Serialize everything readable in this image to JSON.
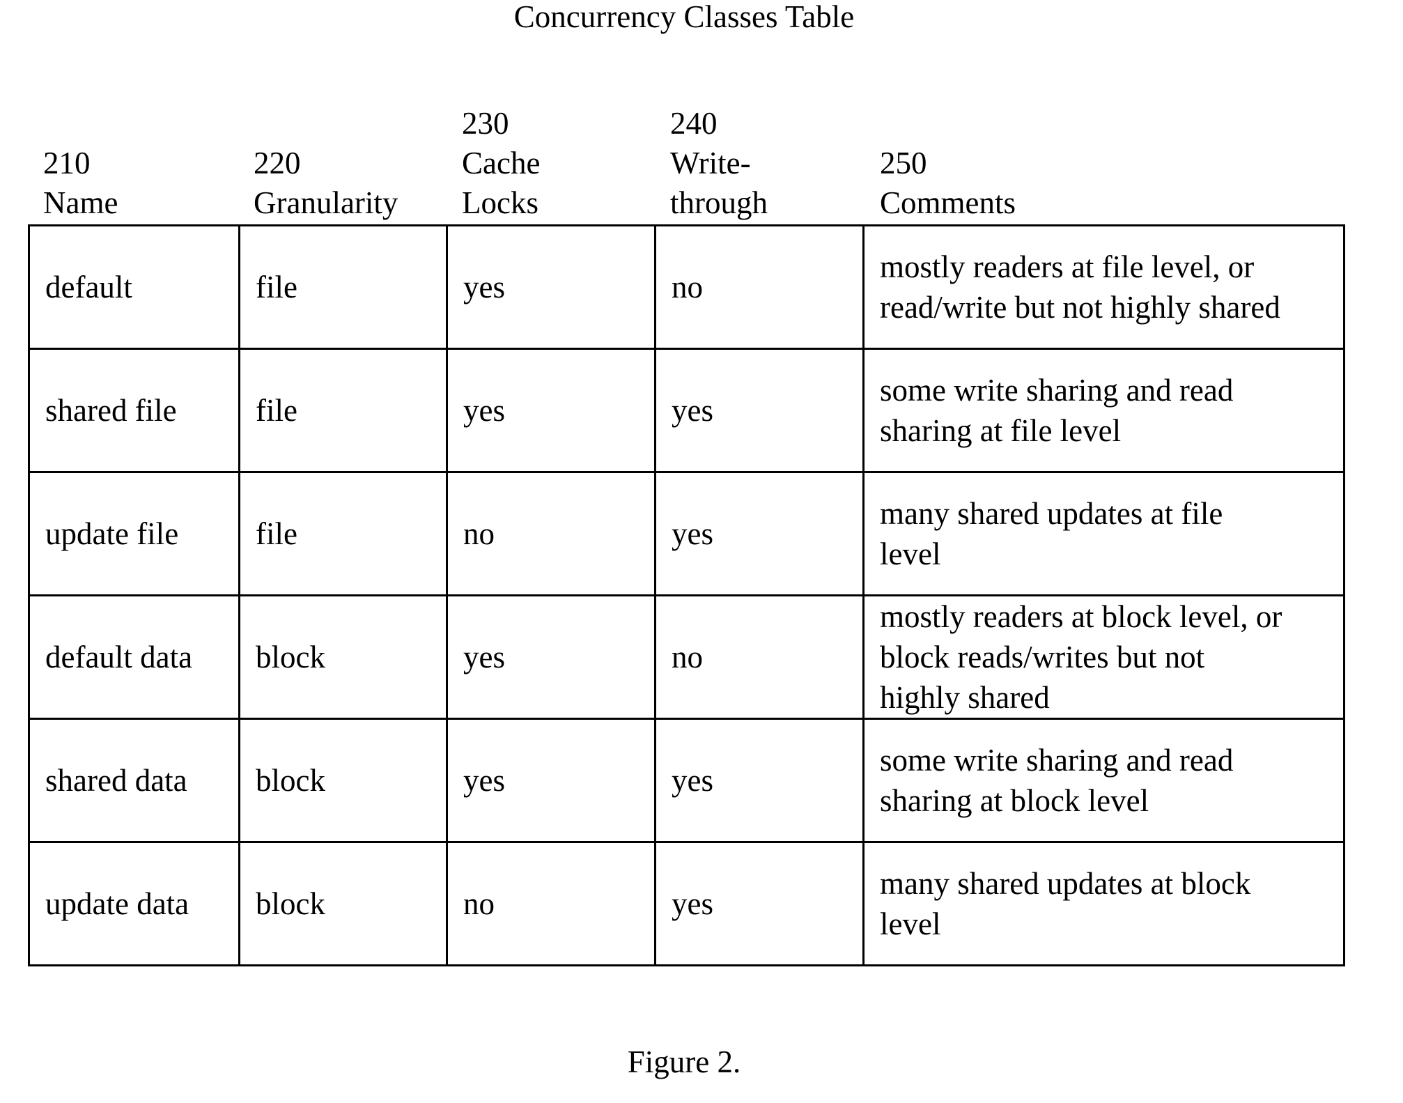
{
  "title": "Concurrency Classes Table",
  "columns": [
    {
      "ref": "210",
      "label_lines": [
        "Name"
      ]
    },
    {
      "ref": "220",
      "label_lines": [
        "Granularity"
      ]
    },
    {
      "ref": "230",
      "label_lines": [
        "Cache",
        "Locks"
      ]
    },
    {
      "ref": "240",
      "label_lines": [
        "Write-",
        "through"
      ]
    },
    {
      "ref": "250",
      "label_lines": [
        "Comments"
      ]
    }
  ],
  "rows": [
    {
      "name": "default",
      "granularity": "file",
      "cache_locks": "yes",
      "write_through": "no",
      "comments": [
        "mostly readers at file level, or",
        "read/write but not highly shared"
      ]
    },
    {
      "name": "shared file",
      "granularity": "file",
      "cache_locks": "yes",
      "write_through": "yes",
      "comments": [
        "some write sharing and read",
        "sharing at file level"
      ]
    },
    {
      "name": "update file",
      "granularity": "file",
      "cache_locks": "no",
      "write_through": "yes",
      "comments": [
        "many shared updates at file",
        "level"
      ]
    },
    {
      "name": "default data",
      "granularity": "block",
      "cache_locks": "yes",
      "write_through": "no",
      "comments": [
        "mostly readers at block level, or",
        "block reads/writes but not",
        "highly shared"
      ]
    },
    {
      "name": "shared data",
      "granularity": "block",
      "cache_locks": "yes",
      "write_through": "yes",
      "comments": [
        "some write sharing and read",
        "sharing at block level"
      ]
    },
    {
      "name": "update data",
      "granularity": "block",
      "cache_locks": "no",
      "write_through": "yes",
      "comments": [
        "many shared updates at block",
        "level"
      ]
    }
  ],
  "caption": "Figure 2."
}
